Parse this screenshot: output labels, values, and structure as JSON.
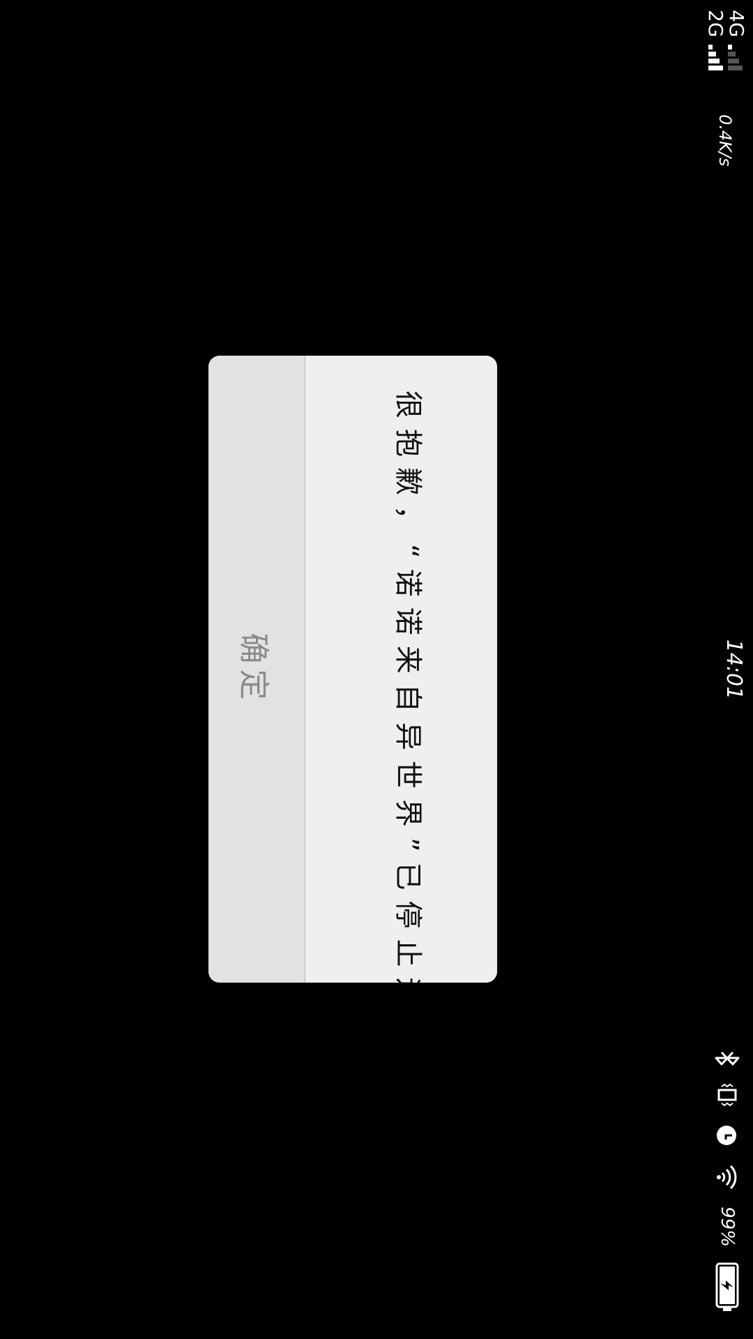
{
  "status_bar": {
    "network_primary": "4G",
    "network_secondary": "2G",
    "network_speed": "0.4K/s",
    "time": "14:01",
    "battery_percent": "99%",
    "icons": [
      "bluetooth-icon",
      "vibrate-icon",
      "alarm-icon",
      "wifi-icon",
      "battery-charging-icon"
    ]
  },
  "dialog": {
    "message": "很抱歉，“诺诺来自异世界”已停止运行。",
    "confirm_label": "确定"
  }
}
